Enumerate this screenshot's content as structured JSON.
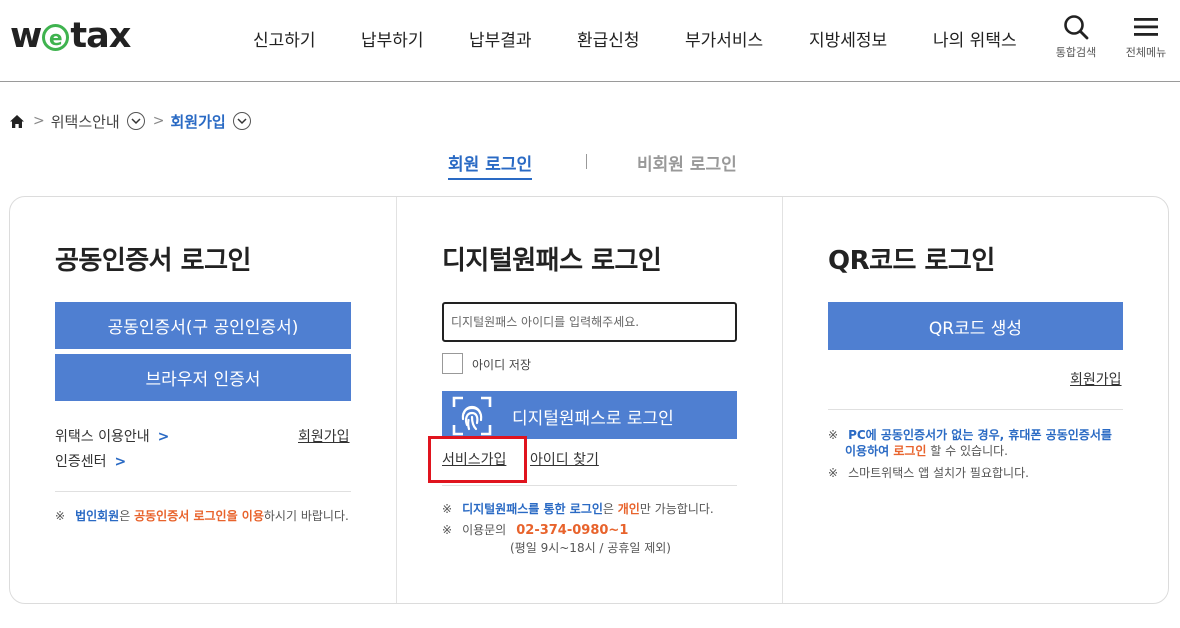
{
  "header": {
    "logo": {
      "pre": "w",
      "mid": "e",
      "post": "tax"
    },
    "nav": [
      "신고하기",
      "납부하기",
      "납부결과",
      "환급신청",
      "부가서비스",
      "지방세정보",
      "나의 위택스"
    ],
    "search_label": "통합검색",
    "menu_label": "전체메뉴"
  },
  "breadcrumb": {
    "home_icon": "home-icon",
    "items": [
      "위택스안내",
      "회원가입"
    ]
  },
  "tabs": {
    "member": "회원 로그인",
    "nonmember": "비회원 로그인"
  },
  "cert": {
    "title": "공동인증서 로그인",
    "btn_cert": "공동인증서(구 공인인증서)",
    "btn_browser": "브라우저 인증서",
    "link_guide": "위택스 이용안내",
    "link_center": "인증센터",
    "link_signup": "회원가입",
    "note": {
      "mark": "※",
      "p1": "법인회원",
      "p2": "은 ",
      "p3": "공동인증서 로그인을 이용",
      "p4": "하시기 바랍니다."
    }
  },
  "digital": {
    "title": "디지털원패스 로그인",
    "input_placeholder": "디지털원패스 아이디를 입력해주세요.",
    "save_id": "아이디 저장",
    "login_btn": "디지털원패스로 로그인",
    "service_signup": "서비스가입",
    "find_id": "아이디 찾기",
    "note1": {
      "mark": "※",
      "p1": "디지털원패스를 통한 로그인",
      "p2": "은 ",
      "p3": "개인",
      "p4": "만 가능합니다."
    },
    "note2": {
      "mark": "※",
      "p1": "이용문의",
      "phone": "02-374-0980~1",
      "hours": "(평일 9시~18시 / 공휴일 제외)"
    }
  },
  "qr": {
    "title": "QR코드 로그인",
    "btn": "QR코드 생성",
    "signup": "회원가입",
    "note1": {
      "mark": "※",
      "line1": "PC에 공동인증서가 없는 경우, 휴대폰 공동인증서를",
      "line2a": "이용하여 ",
      "line2b": "로그인",
      "line2c": " 할 수 있습니다."
    },
    "note2": {
      "mark": "※",
      "text": "스마트위택스 앱 설치가 필요합니다."
    }
  },
  "colors": {
    "accent": "#2a6ac4",
    "button": "#4f7fd1",
    "highlight": "#e8632c",
    "logo_green": "#3fb34f",
    "annotation": "#e0141e"
  }
}
